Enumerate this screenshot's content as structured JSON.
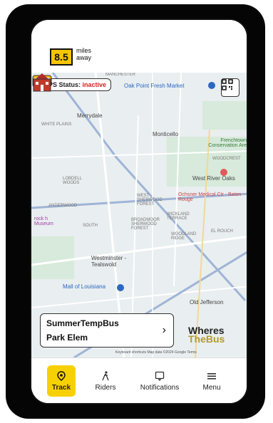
{
  "distance": {
    "value": "8.5",
    "unit": "miles away"
  },
  "gps": {
    "label": "GPS Status:",
    "status": "inactive"
  },
  "map": {
    "labels": {
      "manchester": "MANCHESTER",
      "oak_point": "Oak Point Fresh Market",
      "merrydale": "Merrydale",
      "white_plains": "WHITE PLAINS",
      "monticello": "Monticello",
      "frenchtown": "Frenchtown Conservation Are",
      "woodcrest": "WOODCREST",
      "lobdell": "LOBDELL WOODS",
      "west_river_oaks": "West River Oaks",
      "ochsner": "Ochsner Medical Ctr - Baton Rouge",
      "westside": "WEST SHERWOOD FOREST",
      "anderwood": "ANDERWOOD",
      "broadmoor": "BROADMOOR SHERWOOD FOREST",
      "wickland": "WICKLAND TERRACE",
      "brook_museum": "rock h Museum",
      "south": "SOUTH",
      "woodland": "WOODLAND RIDGE",
      "el_rouch": "EL ROUCH",
      "westminster": "Westminster - Tealswold",
      "mall": "Mall of Louisiana",
      "old_jefferson": "Old Jefferson",
      "attribution": "Keyboard shortcuts   Map data ©2024 Google   Terms"
    }
  },
  "card": {
    "line1": "SummerTempBus",
    "line2": "Park  Elem",
    "arrow": "›"
  },
  "brand": {
    "line1": "Wheres",
    "line2": "TheBus"
  },
  "nav": {
    "track": "Track",
    "riders": "Riders",
    "notifications": "Notifications",
    "menu": "Menu"
  },
  "icons": {
    "track": "location-pin-icon",
    "riders": "person-walking-icon",
    "notifications": "notification-icon",
    "menu": "hamburger-menu-icon"
  }
}
